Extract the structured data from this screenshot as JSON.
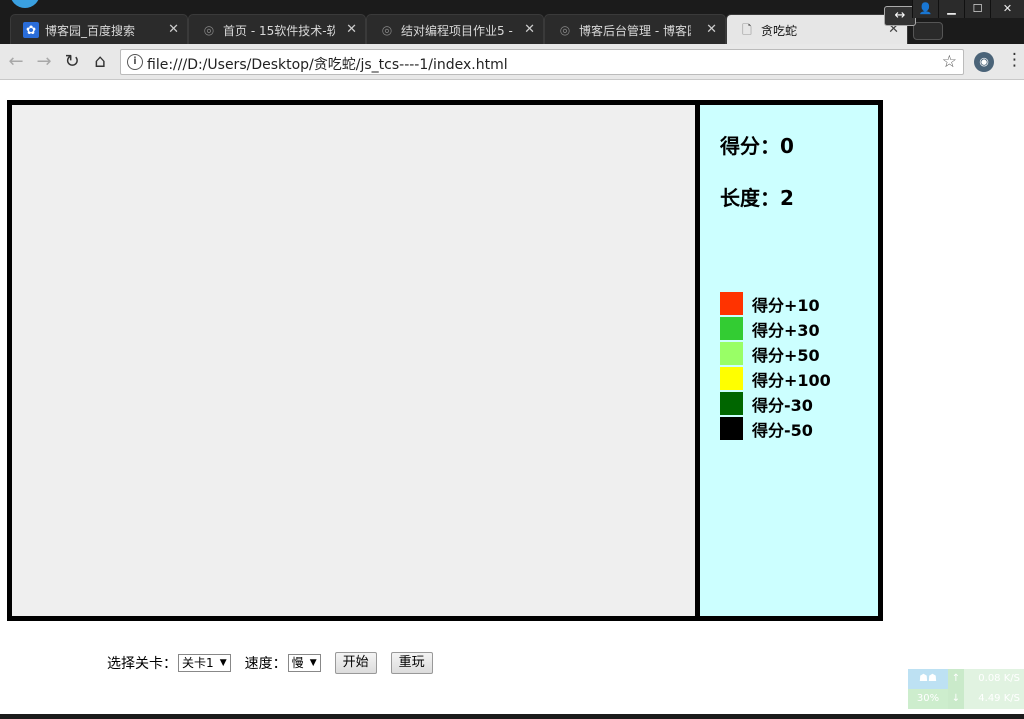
{
  "browser": {
    "tabs": [
      {
        "label": "博客园_百度搜索",
        "icon": "paw-icon",
        "active": false
      },
      {
        "label": "首页 - 15软件技术-软",
        "icon": "cnblogs-icon",
        "active": false
      },
      {
        "label": "结对编程项目作业5 - ",
        "icon": "cnblogs-icon",
        "active": false
      },
      {
        "label": "博客后台管理 - 博客园",
        "icon": "cnblogs-icon",
        "active": false
      },
      {
        "label": "贪吃蛇",
        "icon": "page-icon",
        "active": true
      }
    ],
    "url": "file:///D:/Users/Desktop/贪吃蛇/js_tcs----1/index.html"
  },
  "game": {
    "score_label": "得分：0",
    "length_label": "长度：2",
    "legend": [
      {
        "label": "得分+10",
        "color": "#ff3300"
      },
      {
        "label": "得分+30",
        "color": "#33cc33"
      },
      {
        "label": "得分+50",
        "color": "#99ff66"
      },
      {
        "label": "得分+100",
        "color": "#ffff00"
      },
      {
        "label": "得分-30",
        "color": "#006600"
      },
      {
        "label": "得分-50",
        "color": "#000000"
      }
    ],
    "play_area_color": "#efefef",
    "panel_color": "#ccffff"
  },
  "controls": {
    "level_label": "选择关卡：",
    "level_value": "关卡1",
    "speed_label": "速度：",
    "speed_value": "慢",
    "start_button": "开始",
    "restart_button": "重玩"
  },
  "net_widget": {
    "up_speed": "0.08 K/S",
    "down_speed": "4.49 K/S",
    "percent": "30%"
  }
}
